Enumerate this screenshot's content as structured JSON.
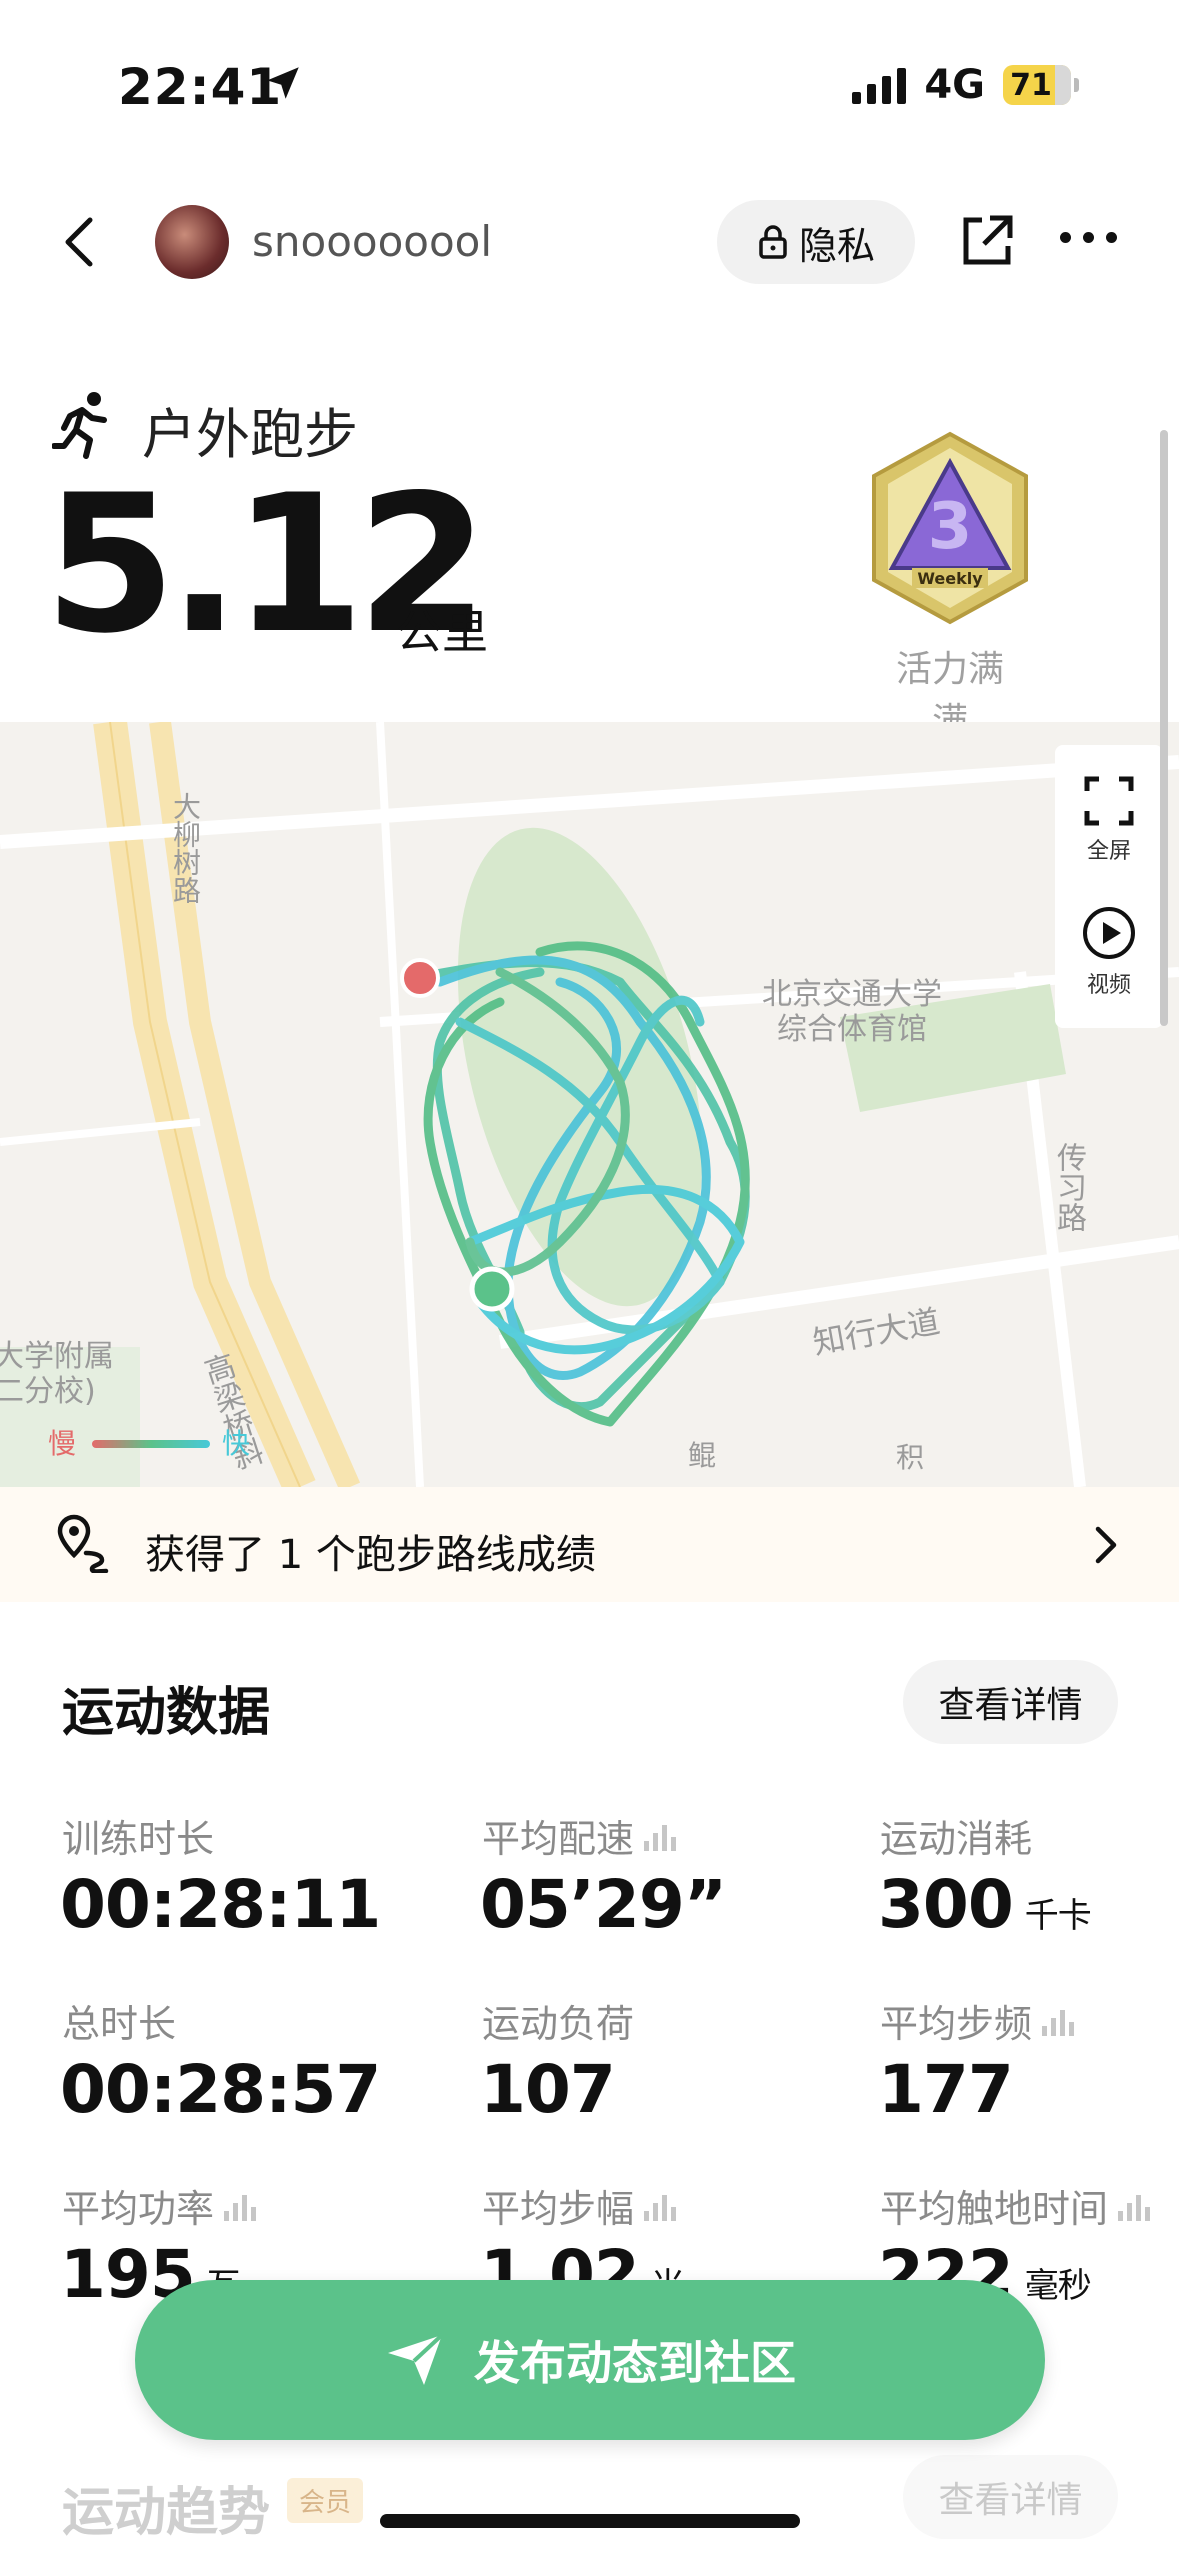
{
  "status_bar": {
    "time": "22:41",
    "network": "4G",
    "battery": "71"
  },
  "header": {
    "username": "snoooooool",
    "privacy_label": "隐私"
  },
  "activity": {
    "type": "户外跑步",
    "distance": "5.12",
    "distance_unit": "公里",
    "badge_label": "活力满满",
    "badge_text": "Weekly"
  },
  "map": {
    "labels": {
      "road1": "大柳树路",
      "gym": "北京交通大学\n综合体育馆",
      "chuanxi": "传习路",
      "zhixing": "知行大道",
      "school": "大学附属\n二分校)",
      "gaoliang": "高梁桥斜",
      "kun": "鲲",
      "ji": "积"
    },
    "controls": {
      "fullscreen": "全屏",
      "video": "视频"
    },
    "legend": {
      "slow": "慢",
      "fast": "快"
    }
  },
  "achievement": {
    "text": "获得了 1 个跑步路线成绩"
  },
  "stats": {
    "title": "运动数据",
    "detail_btn": "查看详情",
    "items": [
      {
        "label": "训练时长",
        "value": "00:28:11",
        "unit": ""
      },
      {
        "label": "平均配速",
        "value": "05’29”",
        "unit": ""
      },
      {
        "label": "运动消耗",
        "value": "300",
        "unit": "千卡"
      },
      {
        "label": "总时长",
        "value": "00:28:57",
        "unit": ""
      },
      {
        "label": "运动负荷",
        "value": "107",
        "unit": ""
      },
      {
        "label": "平均步频",
        "value": "177",
        "unit": ""
      },
      {
        "label": "平均功率",
        "value": "195",
        "unit": "瓦"
      },
      {
        "label": "平均步幅",
        "value": "1.02",
        "unit": "米"
      },
      {
        "label": "平均触地时间",
        "value": "222",
        "unit": "毫秒"
      }
    ]
  },
  "publish": {
    "label": "发布动态到社区"
  },
  "trend": {
    "title": "运动趋势",
    "vip": "会员",
    "detail_btn": "查看详情"
  },
  "colors": {
    "accent": "#5bc28a",
    "track_slow": "#e46a6a",
    "track_fast": "#47c9d8",
    "park": "#d7e8cd"
  }
}
